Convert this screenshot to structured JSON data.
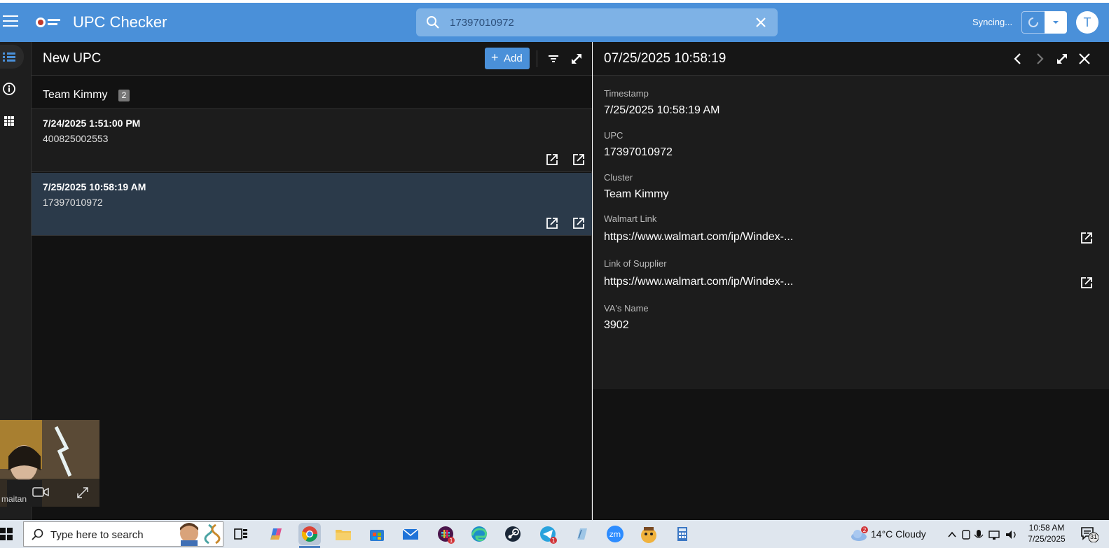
{
  "header": {
    "app_title": "UPC Checker",
    "search_value": "17397010972",
    "sync_status": "Syncing...",
    "avatar_letter": "T"
  },
  "list_pane": {
    "title": "New UPC",
    "add_label": "Add",
    "group": {
      "name": "Team Kimmy",
      "count": "2"
    },
    "rows": [
      {
        "date": "7/24/2025 1:51:00 PM",
        "upc": "400825002553"
      },
      {
        "date": "7/25/2025 10:58:19 AM",
        "upc": "17397010972"
      }
    ]
  },
  "detail_pane": {
    "title": "07/25/2025 10:58:19",
    "fields": [
      {
        "label": "Timestamp",
        "value": "7/25/2025 10:58:19 AM"
      },
      {
        "label": "UPC",
        "value": "17397010972"
      },
      {
        "label": "Cluster",
        "value": "Team Kimmy"
      },
      {
        "label": "Walmart Link",
        "value": "https://www.walmart.com/ip/Windex-..."
      },
      {
        "label": "Link of Supplier",
        "value": "https://www.walmart.com/ip/Windex-..."
      },
      {
        "label": "VA's Name",
        "value": "3902"
      }
    ]
  },
  "webcam": {
    "name": "maitan"
  },
  "taskbar": {
    "search_placeholder": "Type here to search",
    "weather": "14°C  Cloudy",
    "time": "10:58 AM",
    "date": "7/25/2025",
    "notifications": "31"
  },
  "colors": {
    "accent": "#4a90d9",
    "selected_row": "#2b3a4a",
    "pane_bg": "#121212"
  }
}
